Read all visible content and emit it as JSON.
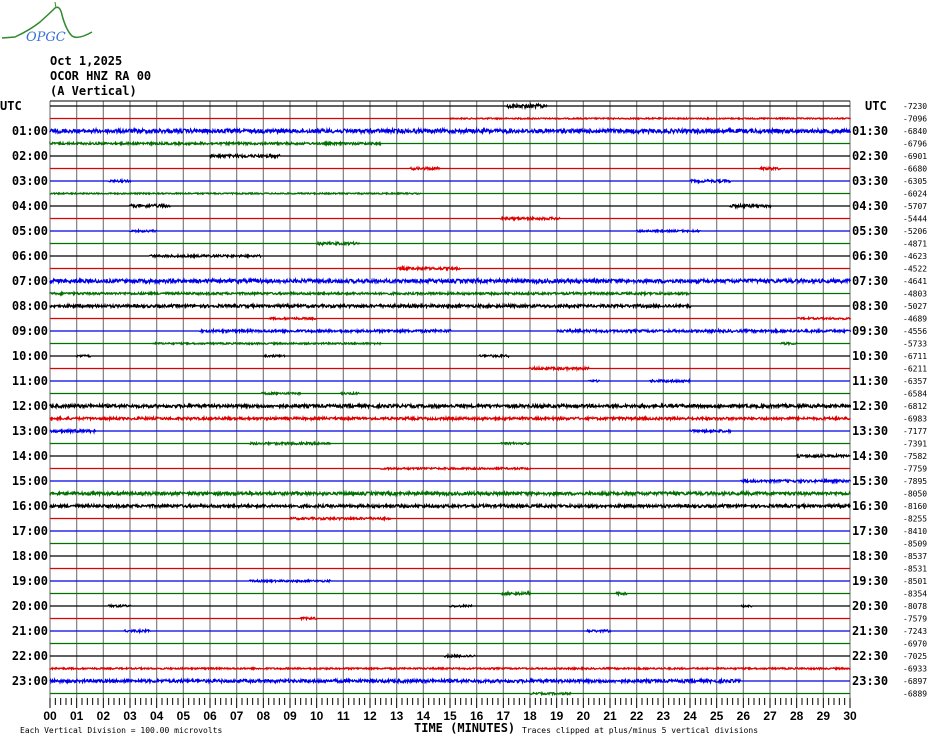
{
  "logo": {
    "text": "OPGC"
  },
  "header": {
    "date": "Oct 1,2025",
    "station": "OCOR HNZ RA 00",
    "component": "(A Vertical)"
  },
  "colors": {
    "cycle": [
      "#000000",
      "#e00000",
      "#0000e8",
      "#007000"
    ],
    "grid": "#808080"
  },
  "chart_data": {
    "type": "line",
    "title": "Helicorder OCOR HNZ RA 00 (A Vertical) Oct 1,2025",
    "xlabel": "TIME (MINUTES)",
    "x_range": [
      0,
      30
    ],
    "x_ticks": [
      "00",
      "01",
      "02",
      "03",
      "04",
      "05",
      "06",
      "07",
      "08",
      "09",
      "10",
      "11",
      "12",
      "13",
      "14",
      "15",
      "16",
      "17",
      "18",
      "19",
      "20",
      "21",
      "22",
      "23",
      "24",
      "25",
      "26",
      "27",
      "28",
      "29",
      "30"
    ],
    "left_labels": [
      "UTC",
      "01:00",
      "02:00",
      "03:00",
      "04:00",
      "05:00",
      "06:00",
      "07:00",
      "08:00",
      "09:00",
      "10:00",
      "11:00",
      "12:00",
      "13:00",
      "14:00",
      "15:00",
      "16:00",
      "17:00",
      "18:00",
      "19:00",
      "20:00",
      "21:00",
      "22:00",
      "23:00"
    ],
    "right_labels": [
      "UTC",
      "01:30",
      "02:30",
      "03:30",
      "04:30",
      "05:30",
      "06:30",
      "07:30",
      "08:30",
      "09:30",
      "10:30",
      "11:30",
      "12:30",
      "13:30",
      "14:30",
      "15:30",
      "16:30",
      "17:30",
      "18:30",
      "19:30",
      "20:30",
      "21:30",
      "22:30",
      "23:30"
    ],
    "trace_offsets": [
      "-7230",
      "-7096",
      "-6840",
      "-6796",
      "-6901",
      "-6680",
      "-6305",
      "-6024",
      "-5707",
      "-5444",
      "-5206",
      "-4871",
      "-4623",
      "-4522",
      "-4641",
      "-4803",
      "-5027",
      "-4689",
      "-4556",
      "-5733",
      "-6711",
      "-6211",
      "-6357",
      "-6584",
      "-6812",
      "-6983",
      "-7177",
      "-7391",
      "-7582",
      "-7759",
      "-7895",
      "-8050",
      "-8160",
      "-8255",
      "-8410",
      "-8509",
      "-8537",
      "-8531",
      "-8501",
      "-8354",
      "-8078",
      "-7579",
      "-7243",
      "-6970",
      "-7025",
      "-6933",
      "-6897",
      "-6889"
    ],
    "bursts_minutes": [
      [
        [
          17.1,
          18.6,
          1.2
        ]
      ],
      [
        [
          15,
          30,
          0.4
        ]
      ],
      [
        [
          0,
          30,
          1.3
        ]
      ],
      [
        [
          0,
          12.4,
          0.7
        ]
      ],
      [
        [
          6,
          8.6,
          0.9
        ]
      ],
      [
        [
          13.5,
          14.6,
          0.8
        ],
        [
          26.6,
          27.4,
          0.8
        ]
      ],
      [
        [
          2.2,
          3,
          0.7
        ],
        [
          24,
          25.5,
          0.8
        ]
      ],
      [
        [
          0,
          13.9,
          0.4
        ]
      ],
      [
        [
          3,
          4.5,
          1
        ],
        [
          25.5,
          27,
          0.9
        ]
      ],
      [
        [
          16.9,
          19.1,
          0.8
        ]
      ],
      [
        [
          3,
          4,
          0.6
        ],
        [
          22,
          24.4,
          0.6
        ]
      ],
      [
        [
          10,
          11.6,
          0.8
        ]
      ],
      [
        [
          3.75,
          7.9,
          0.7
        ]
      ],
      [
        [
          13,
          15.4,
          0.8
        ]
      ],
      [
        [
          0,
          30,
          1.2
        ]
      ],
      [
        [
          0,
          24,
          0.7
        ]
      ],
      [
        [
          0,
          24,
          0.9
        ]
      ],
      [
        [
          8.2,
          10,
          0.6
        ],
        [
          28,
          30,
          0.6
        ]
      ],
      [
        [
          5.6,
          15,
          0.8
        ],
        [
          19,
          30,
          0.8
        ]
      ],
      [
        [
          3.8,
          12.4,
          0.5
        ],
        [
          27.4,
          28,
          0.7
        ]
      ],
      [
        [
          1,
          1.5,
          0.7
        ],
        [
          8,
          8.8,
          0.6
        ],
        [
          16.1,
          17.2,
          0.7
        ]
      ],
      [
        [
          18,
          20.2,
          0.8
        ]
      ],
      [
        [
          20.2,
          20.6,
          0.6
        ],
        [
          22.5,
          24,
          0.8
        ]
      ],
      [
        [
          7.9,
          9.4,
          0.6
        ],
        [
          10.9,
          11.6,
          0.6
        ]
      ],
      [
        [
          0,
          30,
          1
        ]
      ],
      [
        [
          0,
          30,
          0.8
        ]
      ],
      [
        [
          0,
          1.7,
          0.9
        ],
        [
          24,
          25.5,
          0.8
        ]
      ],
      [
        [
          7.5,
          10.5,
          0.7
        ],
        [
          16.9,
          18,
          0.6
        ]
      ],
      [
        [
          28,
          30,
          0.8
        ]
      ],
      [
        [
          12.4,
          18,
          0.6
        ]
      ],
      [
        [
          25.9,
          30,
          0.8
        ]
      ],
      [
        [
          0,
          30,
          1
        ]
      ],
      [
        [
          0,
          30,
          0.9
        ]
      ],
      [
        [
          9,
          12.75,
          0.7
        ]
      ],
      [],
      [],
      [],
      [],
      [
        [
          7.5,
          10.5,
          0.6
        ]
      ],
      [
        [
          16.9,
          18,
          0.8
        ],
        [
          21.2,
          21.6,
          0.8
        ]
      ],
      [
        [
          2.2,
          3,
          0.7
        ],
        [
          15,
          15.8,
          0.6
        ],
        [
          25.9,
          26.3,
          0.6
        ]
      ],
      [
        [
          9.4,
          10,
          0.8
        ]
      ],
      [
        [
          2.8,
          3.75,
          0.7
        ],
        [
          20.1,
          21,
          0.7
        ]
      ],
      [],
      [
        [
          14.8,
          15.9,
          0.7
        ]
      ],
      [
        [
          0,
          30,
          0.5
        ]
      ],
      [
        [
          0,
          25.9,
          1
        ]
      ],
      [
        [
          18,
          19.5,
          0.6
        ]
      ]
    ]
  },
  "footer": {
    "scale": "Each Vertical Division =  100.00 microvolts",
    "axis_title": "TIME (MINUTES)",
    "clip_note": "Traces clipped at plus/minus 5 vertical divisions"
  }
}
